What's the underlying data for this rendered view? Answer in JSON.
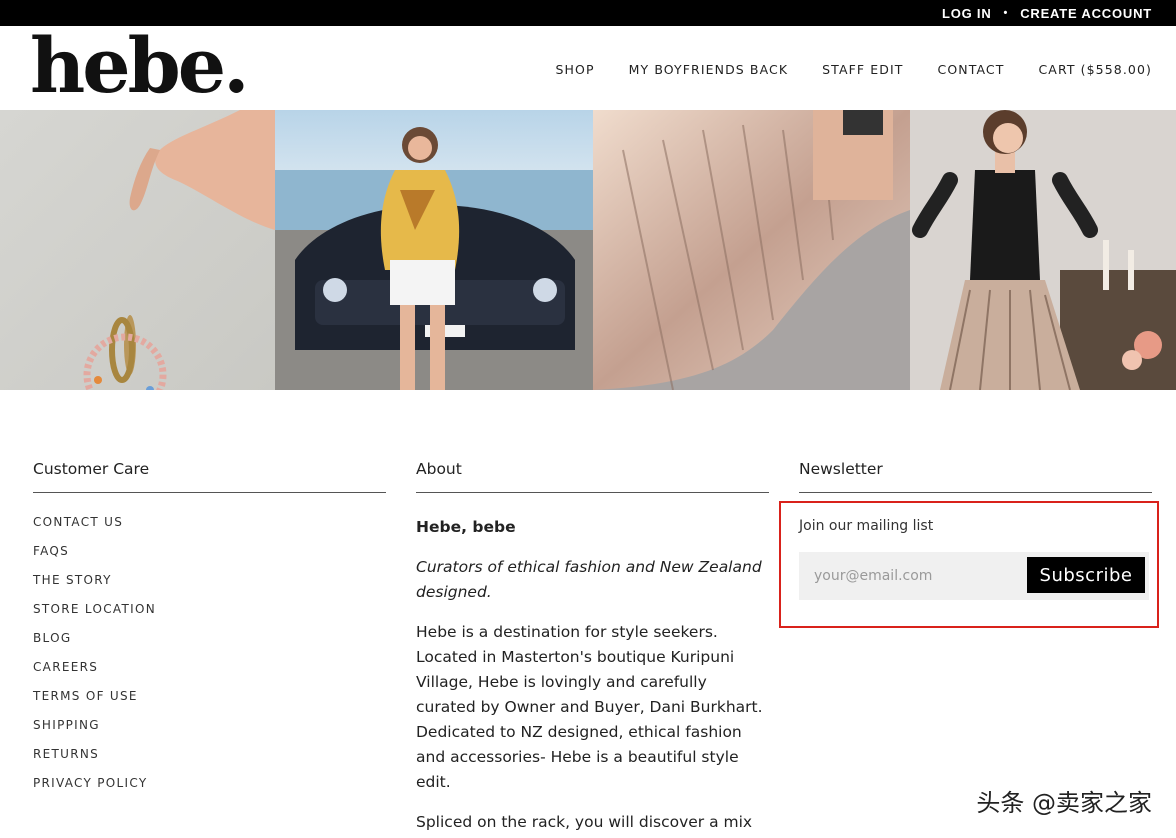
{
  "topbar": {
    "login": "LOG IN",
    "separator": "•",
    "create_account": "CREATE ACCOUNT"
  },
  "header": {
    "logo": "hebe.",
    "nav": [
      "SHOP",
      "MY BOYFRIENDS BACK",
      "STAFF EDIT",
      "CONTACT",
      "CART ($558.00)"
    ]
  },
  "footer": {
    "customer_care": {
      "title": "Customer Care",
      "links": [
        "CONTACT US",
        "FAQS",
        "THE STORY",
        "STORE LOCATION",
        "BLOG",
        "CAREERS",
        "TERMS OF USE",
        "SHIPPING",
        "RETURNS",
        "PRIVACY POLICY"
      ]
    },
    "about": {
      "title": "About",
      "heading": "Hebe, bebe",
      "tagline": "Curators of ethical fashion and New Zealand designed.",
      "paragraph1": "Hebe is a destination for style seekers. Located in Masterton's boutique Kuripuni Village, Hebe is lovingly and carefully curated by Owner and Buyer, Dani Burkhart. Dedicated to NZ designed, ethical fashion and accessories- Hebe is a beautiful style edit.",
      "paragraph2": "Spliced on the rack, you will discover a mix"
    },
    "newsletter": {
      "title": "Newsletter",
      "label": "Join our mailing list",
      "placeholder": "your@email.com",
      "button": "Subscribe"
    }
  },
  "watermark": "头条 @卖家之家",
  "gallery": [
    "hand-holding-bead-bracelet",
    "woman-in-floral-shirt-by-car",
    "metallic-pleated-skirt",
    "woman-in-feather-top"
  ],
  "colors": {
    "topbar": "#000000",
    "highlight_border": "#d9221b",
    "button": "#000000",
    "input_bg": "#f0f0f0"
  }
}
